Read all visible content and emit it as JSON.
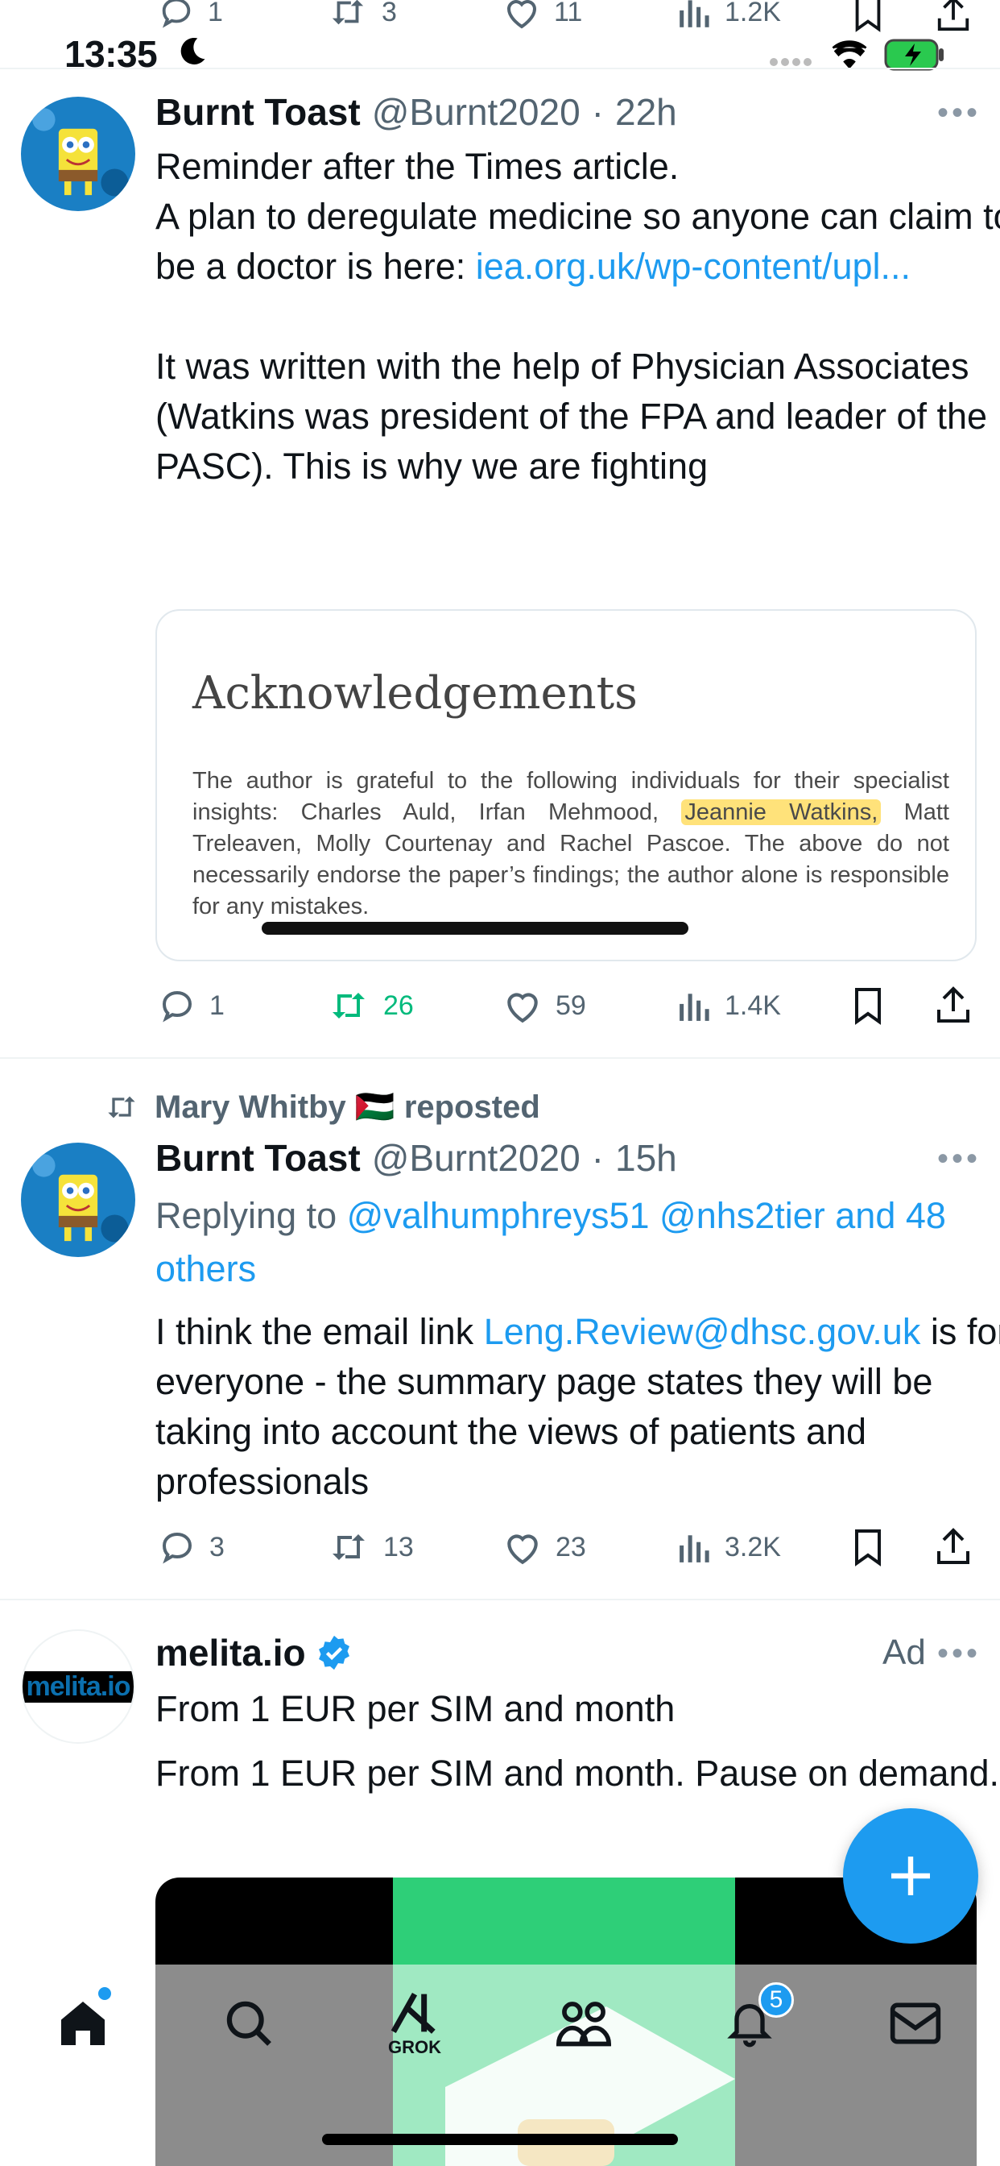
{
  "status_bar": {
    "time": "13:35"
  },
  "previous_tweet_actions": {
    "replies": "1",
    "reposts": "3",
    "likes": "11",
    "views": "1.2K"
  },
  "tweets": [
    {
      "name": "Burnt Toast",
      "handle": "@Burnt2020",
      "time": "22h",
      "text_lines": [
        "Reminder after the Times article.",
        "A plan to deregulate medicine so anyone can claim to be a doctor is here: "
      ],
      "link": "iea.org.uk/wp-content/upl...",
      "paragraph2": "It was written with the help of Physician Associates (Watkins was president of the FPA and leader of the PASC). This is why we are fighting",
      "media": {
        "title": "Acknowledgements",
        "body_before": "The author is grateful to the following individuals for their specialist insights: Charles Auld, Irfan Mehmood, ",
        "highlight": "Jeannie Watkins,",
        "body_after": " Matt Treleaven, Molly Courtenay and Rachel Pascoe. The above do not necessarily endorse the paper’s findings; the author alone is responsible for any mistakes."
      },
      "actions": {
        "replies": "1",
        "reposts": "26",
        "likes": "59",
        "views": "1.4K"
      }
    },
    {
      "repost_by": "Mary Whitby 🇵🇸 reposted",
      "name": "Burnt Toast",
      "handle": "@Burnt2020",
      "time": "15h",
      "replying_prefix": "Replying to ",
      "replying_to": "@valhumphreys51 @nhs2tier and 48 others",
      "text_before": "I think the email link ",
      "email": "Leng.Review@dhsc.gov.uk",
      "text_after": " is for everyone - the summary page states they will be taking into account the views of patients and professionals",
      "actions": {
        "replies": "3",
        "reposts": "13",
        "likes": "23",
        "views": "3.2K"
      }
    }
  ],
  "ad": {
    "name": "melita.io",
    "label": "Ad",
    "logo_text": "melita.io",
    "headline": "From 1 EUR per SIM and month",
    "text": "From 1 EUR per SIM and month. Pause on demand."
  },
  "tabbar": {
    "grok_label": "GROK",
    "notifications_badge": "5"
  },
  "colors": {
    "accent": "#1d9bf0",
    "green": "#00ba7c",
    "muted": "#536471"
  },
  "icons": [
    "reply-icon",
    "repost-icon",
    "like-icon",
    "views-icon",
    "bookmark-icon",
    "share-icon",
    "home-icon",
    "search-icon",
    "grok-icon",
    "communities-icon",
    "notifications-icon",
    "messages-icon",
    "compose-icon",
    "verified-icon"
  ]
}
